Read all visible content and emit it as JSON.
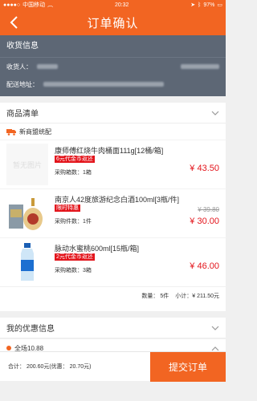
{
  "status_bar": {
    "carrier": "中国移动",
    "time": "20:32",
    "battery": "97%"
  },
  "nav": {
    "title": "订单确认"
  },
  "address": {
    "section_title": "收货信息",
    "receiver_label": "收货人：",
    "address_label": "配送地址："
  },
  "products": {
    "section_title": "商品清单",
    "shipper": "新商盟统配",
    "items": [
      {
        "name": "康师傅红烧牛肉桶面111g[12桶/箱]",
        "promo": "6元代金币返还",
        "qty_label": "采购箱数：1箱",
        "price": "¥ 43.50",
        "thumb_text": "暂无图片"
      },
      {
        "name": "南京人42度旅游纪念白酒100ml[3瓶/件]",
        "promo": "限时特惠",
        "qty_label": "采购件数：1件",
        "old_price": "¥ 39.80",
        "price": "¥ 30.00"
      },
      {
        "name": "脉动水蜜桃600ml[15瓶/箱]",
        "promo": "2元代金币返还",
        "qty_label": "采购箱数：3箱",
        "price": "¥ 46.00"
      }
    ],
    "summary_count": "数量： 5件",
    "summary_subtotal": "小计：¥ 211.50元"
  },
  "coupons": {
    "section_title": "我的优惠信息",
    "row1": "全场10.88"
  },
  "bottom": {
    "totals": "合计：  200.60元(优惠：  20.70元)",
    "submit": "提交订单"
  },
  "colors": {
    "accent": "#f26522",
    "price_red": "#e3141b",
    "address_bg": "#5d6775"
  }
}
